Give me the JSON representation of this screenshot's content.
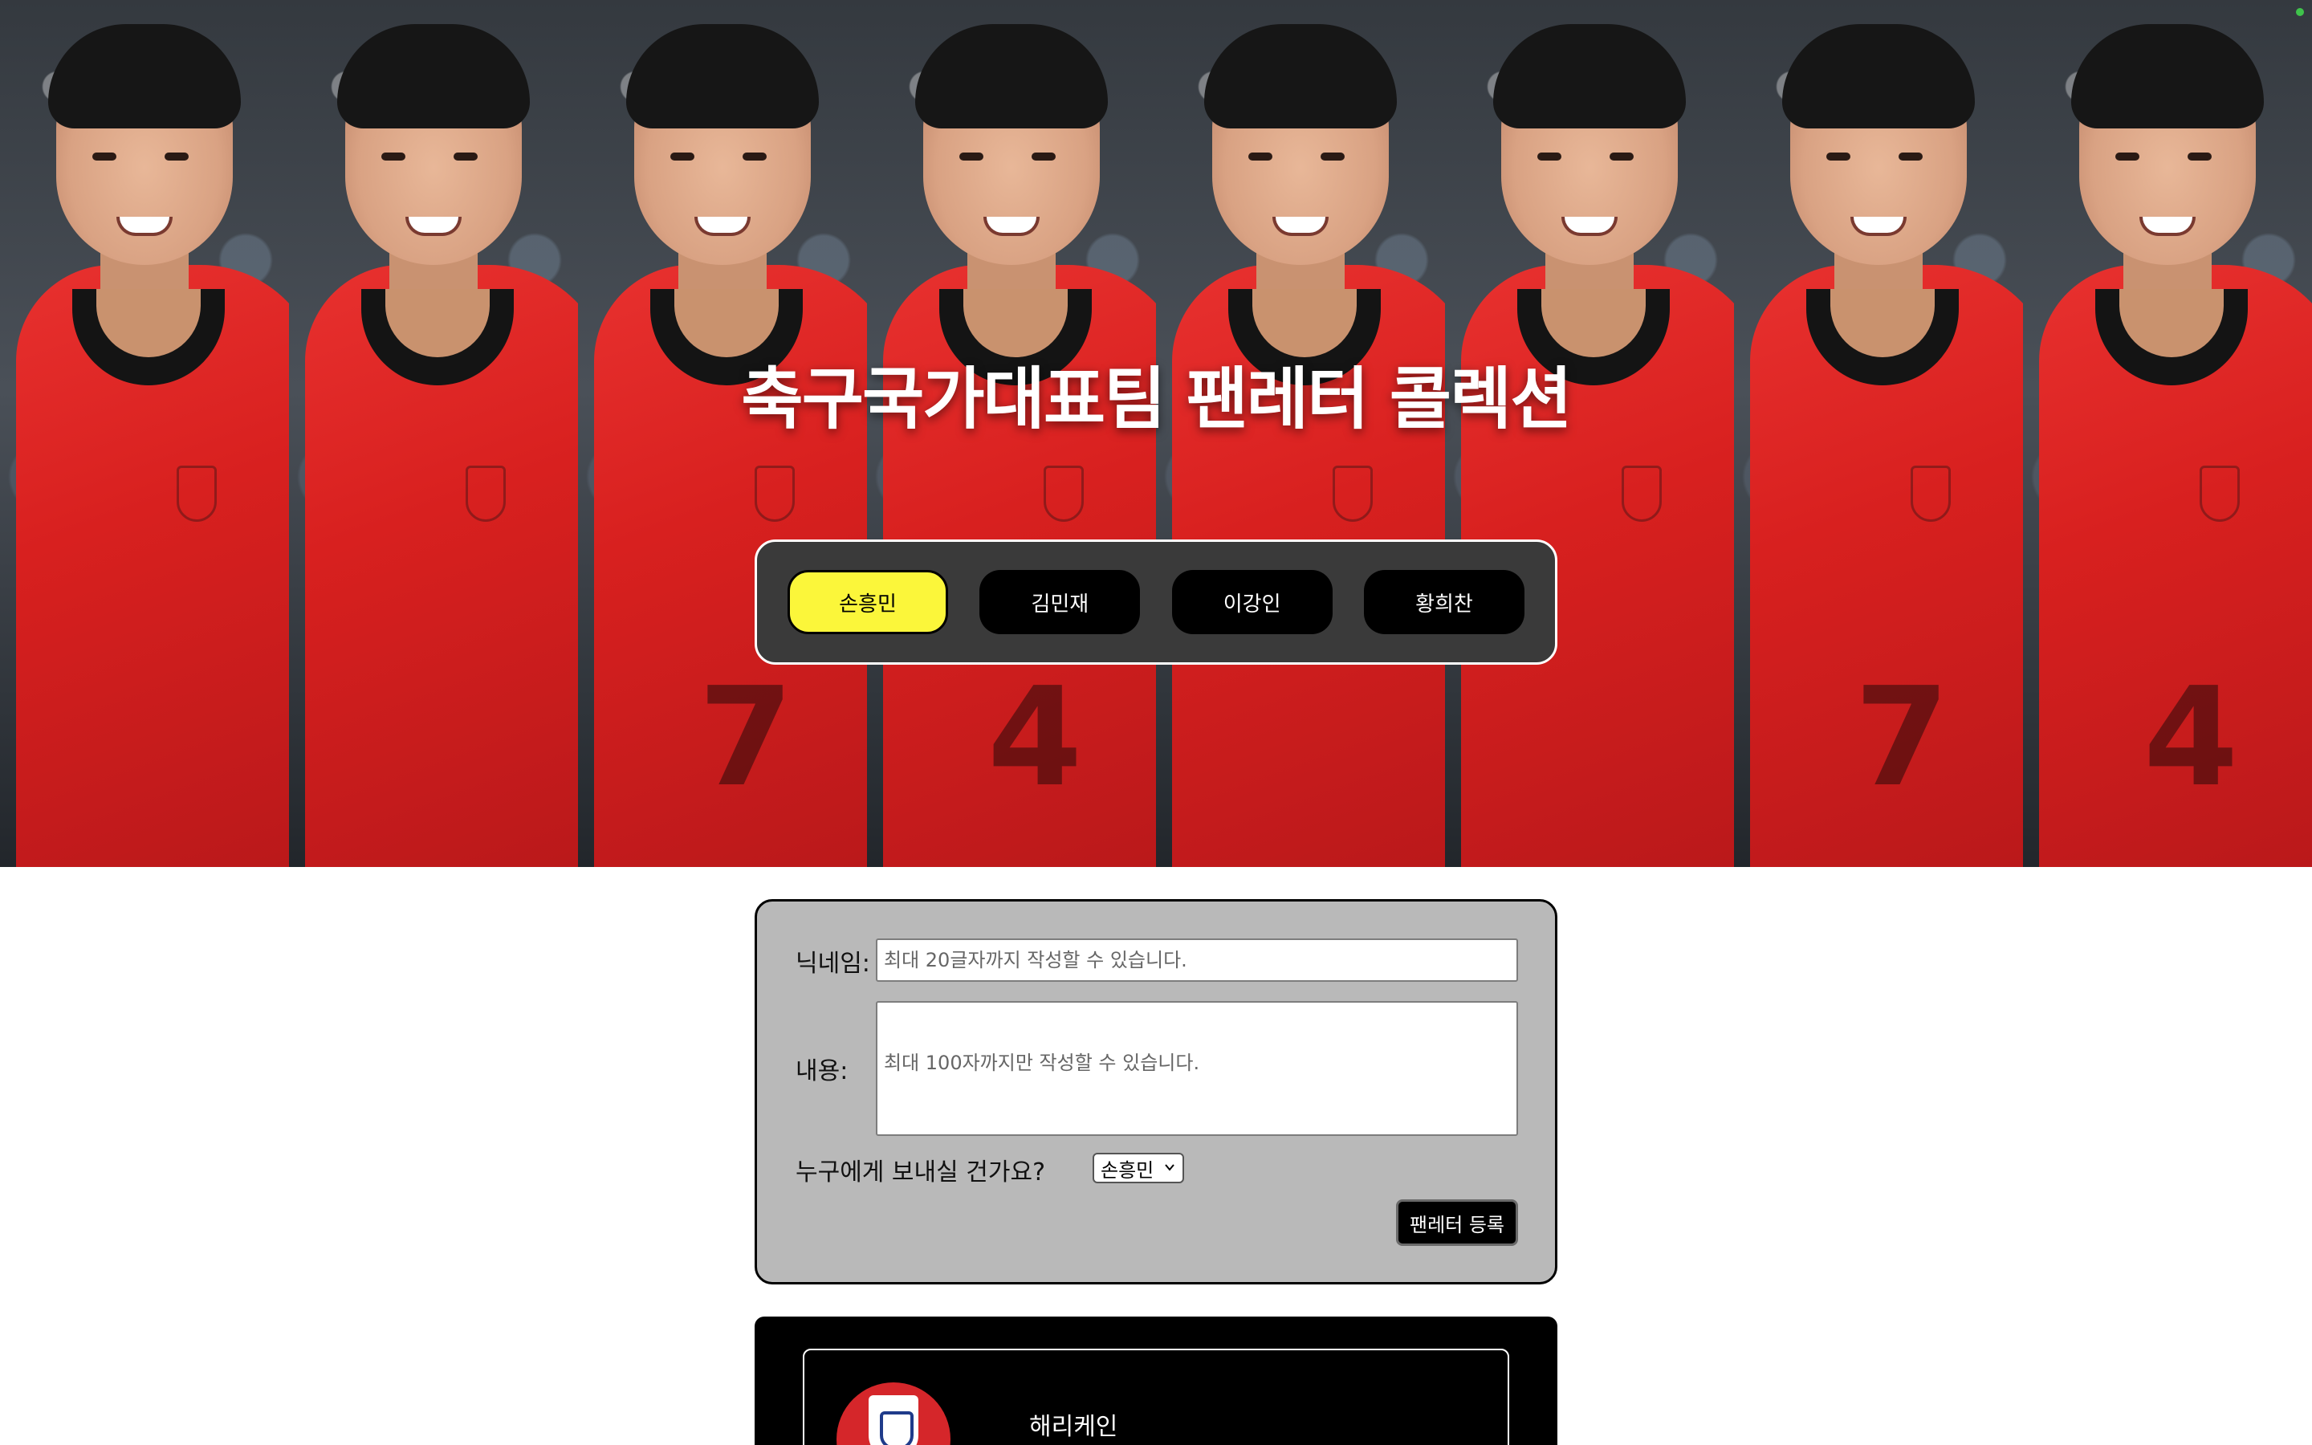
{
  "hero": {
    "title": "축구국가대표팀 팬레터 콜렉션",
    "jersey_numbers": [
      "",
      "",
      "7",
      "4",
      "",
      "",
      "7",
      "4"
    ]
  },
  "tabs": [
    {
      "label": "손흥민",
      "active": true
    },
    {
      "label": "김민재",
      "active": false
    },
    {
      "label": "이강인",
      "active": false
    },
    {
      "label": "황희찬",
      "active": false
    }
  ],
  "form": {
    "nickname_label": "닉네임:",
    "nickname_placeholder": "최대 20글자까지 작성할 수 있습니다.",
    "content_label": "내용:",
    "content_placeholder": "최대 100자까지만 작성할 수 있습니다.",
    "recipient_label": "누구에게 보내실 건가요?",
    "recipient_selected": "손흥민",
    "submit_label": "팬레터 등록"
  },
  "letters": [
    {
      "nickname": "해리케인"
    }
  ],
  "colors": {
    "active_tab": "#fbf63a",
    "tab": "#000000",
    "tabbar_bg": "#3a3a3a",
    "form_bg": "#b9b9b9",
    "jersey_red": "#d8201f"
  }
}
